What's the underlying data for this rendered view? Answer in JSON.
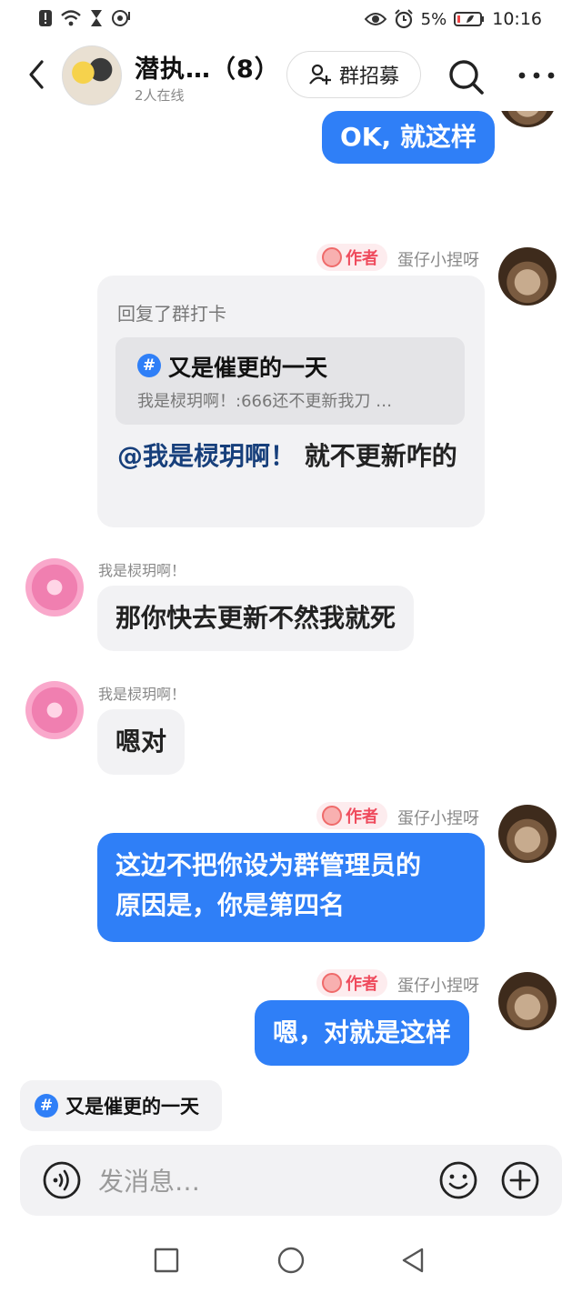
{
  "status_bar": {
    "battery": "5%",
    "time": "10:16",
    "left_icons": [
      "alert-icon",
      "wifi-icon",
      "hourglass-icon",
      "hotspot-icon"
    ],
    "right_icons": [
      "eye-icon",
      "alarm-icon",
      "battery-icon"
    ]
  },
  "header": {
    "group_name": "潜执…（8）",
    "online": "2人在线",
    "recruit_label": "群招募",
    "icons": [
      "back-icon",
      "search-icon",
      "more-icon"
    ]
  },
  "messages": [
    {
      "type": "self",
      "text": "OK, 就这样"
    },
    {
      "type": "self_reply",
      "author_badge": "作者",
      "sender": "蛋仔小捏呀",
      "reply_label": "回复了群打卡",
      "quoted_title": "又是催更的一天",
      "quoted_preview": "我是棂玥啊！:666还不更新我刀 …",
      "mention": "@我是棂玥啊！",
      "text": " 就不更新咋的"
    },
    {
      "type": "other",
      "sender": "我是棂玥啊！",
      "text": "那你快去更新不然我就死"
    },
    {
      "type": "other",
      "sender": "我是棂玥啊！",
      "text": "嗯对"
    },
    {
      "type": "self",
      "author_badge": "作者",
      "sender": "蛋仔小捏呀",
      "lines": [
        "这边不把你设为群管理员的",
        "原因是，你是第四名"
      ]
    },
    {
      "type": "self",
      "author_badge": "作者",
      "sender": "蛋仔小捏呀",
      "text": "嗯，对就是这样"
    }
  ],
  "topic_chip": {
    "hash": "#",
    "label": "又是催更的一天"
  },
  "input_bar": {
    "placeholder": "发消息…"
  },
  "colors": {
    "accent": "#2f7ff7",
    "bubble_gray": "#f2f2f4",
    "author_red": "#ef4b5d",
    "mention": "#173f7b"
  }
}
